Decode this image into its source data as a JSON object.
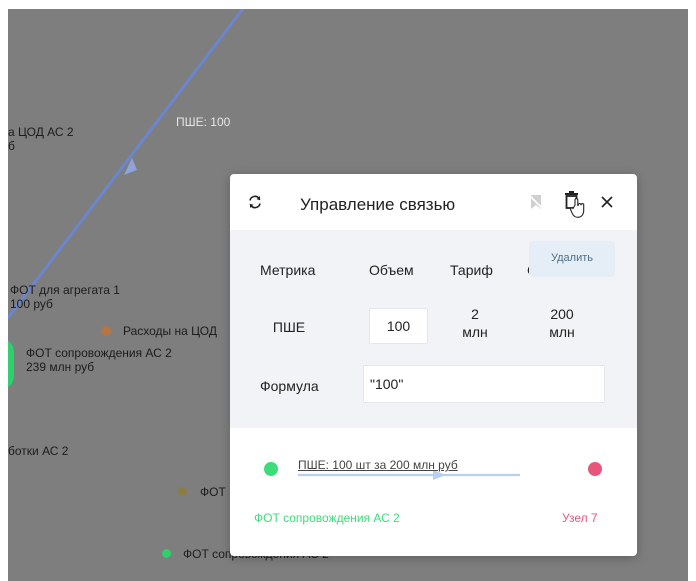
{
  "canvas": {
    "edge_label": "ПШЕ: 100",
    "nodes": [
      {
        "label_lines": [
          "а ЦОД АС 2",
          "б"
        ]
      },
      {
        "label_lines": [
          "ФОТ для агрегата 1",
          "100 руб"
        ]
      },
      {
        "label_lines": [
          "Расходы на ЦОД"
        ]
      },
      {
        "label_lines": [
          "ФОТ сопровождения АС 2",
          "239 млн руб"
        ]
      },
      {
        "label_lines": [
          "ботки АС 2"
        ]
      },
      {
        "label_lines": [
          "ФОТ"
        ]
      },
      {
        "label_lines": [
          "ФОТ сопровождения АС 2"
        ]
      }
    ],
    "colors": {
      "background": "#7e7e7e",
      "edge": "#6a86cf",
      "green": "#2fcf6e",
      "orange": "#b57546",
      "olive": "#8d7d45"
    }
  },
  "modal": {
    "title": "Управление связью",
    "icons": {
      "refresh": "refresh-icon",
      "disabled": "bookmark-off-icon",
      "delete": "trash-icon",
      "close": "close-icon"
    },
    "tooltip": "Удалить",
    "table": {
      "headers": [
        "Метрика",
        "Объем",
        "Тариф",
        "С"
      ],
      "row": {
        "metric": "ПШЕ",
        "volume": "100",
        "tariff_value": "2",
        "tariff_unit": "млн",
        "cost_value": "200",
        "cost_unit": "млн"
      }
    },
    "formula": {
      "label": "Формула",
      "value": "\"100\""
    },
    "link": {
      "text": "ПШЕ: 100 шт за 200 млн руб",
      "source": "ФОТ сопровождения АС 2",
      "target": "Узел 7",
      "source_color": "#3ddc7a",
      "target_color": "#e8557a"
    }
  }
}
